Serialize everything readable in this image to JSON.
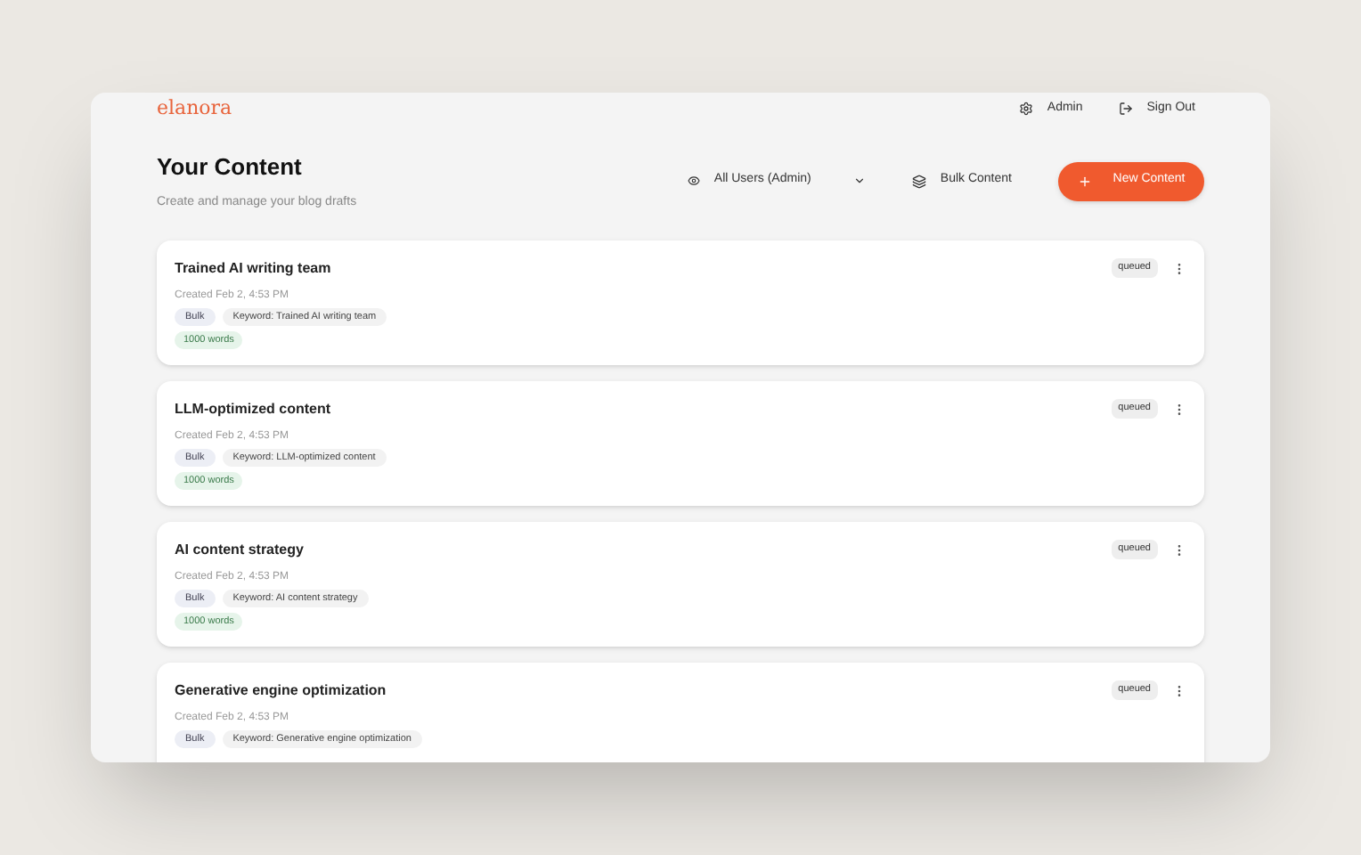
{
  "brand": "elanora",
  "nav": [
    {
      "kind": "admin",
      "label": "Admin"
    },
    {
      "kind": "signout",
      "label": "Sign Out"
    }
  ],
  "page": {
    "title": "Your Content",
    "subtitle": "Create and manage your blog drafts"
  },
  "filter": {
    "value": "All Users (Admin)"
  },
  "bulk_button": "Bulk Content",
  "new_button": "New Content",
  "items": [
    {
      "title": "Trained AI writing team",
      "created": "Created Feb 2, 4:53 PM",
      "tag": "Bulk",
      "keyword": "Keyword: Trained AI writing team",
      "words": "1000 words",
      "status": "queued"
    },
    {
      "title": "LLM-optimized content",
      "created": "Created Feb 2, 4:53 PM",
      "tag": "Bulk",
      "keyword": "Keyword: LLM-optimized content",
      "words": "1000 words",
      "status": "queued"
    },
    {
      "title": "AI content strategy",
      "created": "Created Feb 2, 4:53 PM",
      "tag": "Bulk",
      "keyword": "Keyword: AI content strategy",
      "words": "1000 words",
      "status": "queued"
    },
    {
      "title": "Generative engine optimization",
      "created": "Created Feb 2, 4:53 PM",
      "tag": "Bulk",
      "keyword": "Keyword: Generative engine optimization",
      "status": "queued"
    }
  ]
}
